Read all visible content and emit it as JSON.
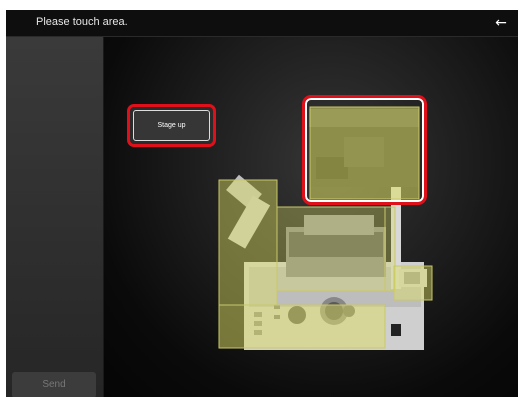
{
  "header": {
    "title": "Please touch area.",
    "back_icon": "arrow-left-icon"
  },
  "sidebar": {
    "send_label": "Send"
  },
  "main": {
    "stage_up_label": "Stage up"
  },
  "colors": {
    "highlight_red": "#e0101a",
    "zone_yellow": "#dede64",
    "background": "#000000"
  }
}
